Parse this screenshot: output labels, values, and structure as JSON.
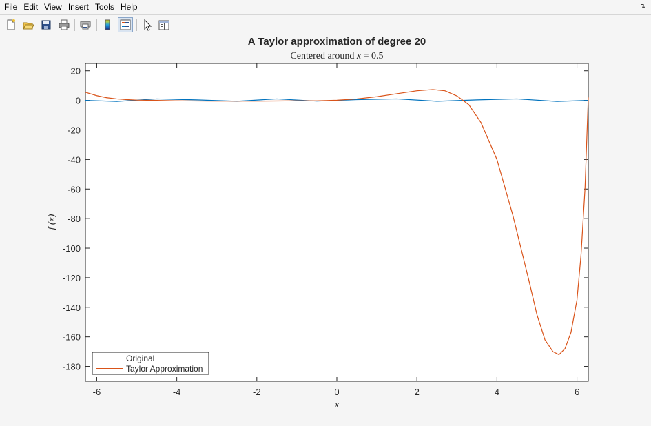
{
  "menubar": {
    "items": [
      "File",
      "Edit",
      "View",
      "Insert",
      "Tools",
      "Help"
    ],
    "corner_icon": "dock-arrow-icon"
  },
  "toolbar": {
    "tools": [
      {
        "name": "new-figure-icon"
      },
      {
        "name": "open-file-icon"
      },
      {
        "name": "save-icon"
      },
      {
        "name": "print-icon"
      },
      {
        "name": "print-preview-icon"
      },
      {
        "name": "colorbar-icon"
      },
      {
        "name": "legend-icon",
        "active": true
      },
      {
        "name": "pointer-icon"
      },
      {
        "name": "property-inspector-icon"
      }
    ]
  },
  "chart_data": {
    "type": "line",
    "title": "A Taylor approximation of degree 20",
    "subtitle": "Centered around x = 0.5",
    "subtitle_var": "x",
    "subtitle_rest": " = 0.5",
    "subtitle_prefix": "Centered around ",
    "xlabel": "x",
    "ylabel": "f (x)",
    "xlim": [
      -6.283,
      6.283
    ],
    "ylim": [
      -190,
      25
    ],
    "xticks": [
      -6,
      -4,
      -2,
      0,
      2,
      4,
      6
    ],
    "yticks": [
      20,
      0,
      -20,
      -40,
      -60,
      -80,
      -100,
      -120,
      -140,
      -160,
      -180
    ],
    "grid": false,
    "legend_position": "bottom-left",
    "series": [
      {
        "name": "Original",
        "color": "#0072bd",
        "x": [
          -6.283,
          -5.5,
          -4.5,
          -3.5,
          -2.5,
          -1.5,
          -0.5,
          0.5,
          1.5,
          2.5,
          3.5,
          4.5,
          5.5,
          6.283
        ],
        "y": [
          0,
          -0.7,
          1.0,
          0.35,
          -0.6,
          1.0,
          -0.5,
          0.5,
          1.0,
          -0.6,
          0.35,
          1.0,
          -0.7,
          0
        ]
      },
      {
        "name": "Taylor Approximation",
        "color": "#d95319",
        "x": [
          -6.283,
          -6.0,
          -5.75,
          -5.5,
          -5.25,
          -5.0,
          -4.5,
          -4.0,
          -3.0,
          -2.0,
          -1.0,
          -0.5,
          0.0,
          0.5,
          1.0,
          1.5,
          2.0,
          2.4,
          2.7,
          3.0,
          3.3,
          3.6,
          4.0,
          4.4,
          4.8,
          5.0,
          5.2,
          5.4,
          5.55,
          5.7,
          5.85,
          6.0,
          6.1,
          6.2,
          6.283
        ],
        "y": [
          5.5,
          3.2,
          1.8,
          1.0,
          0.5,
          0.2,
          0.0,
          -0.3,
          -0.5,
          -0.5,
          -0.3,
          -0.3,
          0.1,
          1.0,
          2.5,
          4.5,
          6.5,
          7.3,
          6.5,
          3.0,
          -3.0,
          -15.0,
          -40.0,
          -78.0,
          -122.0,
          -145.0,
          -162.0,
          -170.0,
          -172.0,
          -168.0,
          -157.0,
          -135.0,
          -105.0,
          -60.0,
          2.0
        ]
      }
    ]
  }
}
